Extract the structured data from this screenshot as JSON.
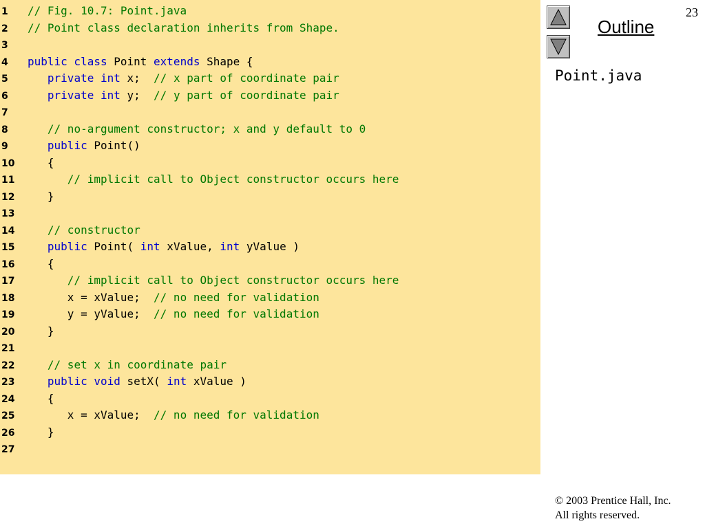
{
  "slide": {
    "number": "23",
    "outline_label": "Outline",
    "file_label": "Point.java",
    "copyright_line1": "© 2003 Prentice Hall, Inc.",
    "copyright_line2": "All rights reserved.",
    "icons": {
      "up": "triangle-up-icon",
      "down": "triangle-down-icon"
    },
    "colors": {
      "panel": "#fde59c",
      "keyword": "#0000cc",
      "comment": "#007700",
      "text": "#000000"
    }
  },
  "code": {
    "lines": [
      {
        "n": "1",
        "tokens": [
          {
            "t": "// Fig. 10.7: Point.java",
            "k": "com"
          }
        ]
      },
      {
        "n": "2",
        "tokens": [
          {
            "t": "// Point class declaration inherits from Shape.",
            "k": "com"
          }
        ]
      },
      {
        "n": "3",
        "tokens": []
      },
      {
        "n": "4",
        "tokens": [
          {
            "t": "public class",
            "k": "kw"
          },
          {
            "t": " Point ",
            "k": "plain"
          },
          {
            "t": "extends",
            "k": "kw"
          },
          {
            "t": " Shape {",
            "k": "plain"
          }
        ]
      },
      {
        "n": "5",
        "tokens": [
          {
            "t": "   ",
            "k": "plain"
          },
          {
            "t": "private int",
            "k": "kw"
          },
          {
            "t": " x;  ",
            "k": "plain"
          },
          {
            "t": "// x part of coordinate pair",
            "k": "com"
          }
        ]
      },
      {
        "n": "6",
        "tokens": [
          {
            "t": "   ",
            "k": "plain"
          },
          {
            "t": "private int",
            "k": "kw"
          },
          {
            "t": " y;  ",
            "k": "plain"
          },
          {
            "t": "// y part of coordinate pair",
            "k": "com"
          }
        ]
      },
      {
        "n": "7",
        "tokens": []
      },
      {
        "n": "8",
        "tokens": [
          {
            "t": "   ",
            "k": "plain"
          },
          {
            "t": "// no-argument constructor; x and y default to 0",
            "k": "com"
          }
        ]
      },
      {
        "n": "9",
        "tokens": [
          {
            "t": "   ",
            "k": "plain"
          },
          {
            "t": "public",
            "k": "kw"
          },
          {
            "t": " Point()",
            "k": "plain"
          }
        ]
      },
      {
        "n": "10",
        "tokens": [
          {
            "t": "   {",
            "k": "plain"
          }
        ]
      },
      {
        "n": "11",
        "tokens": [
          {
            "t": "      ",
            "k": "plain"
          },
          {
            "t": "// implicit call to Object constructor occurs here",
            "k": "com"
          }
        ]
      },
      {
        "n": "12",
        "tokens": [
          {
            "t": "   }",
            "k": "plain"
          }
        ]
      },
      {
        "n": "13",
        "tokens": []
      },
      {
        "n": "14",
        "tokens": [
          {
            "t": "   ",
            "k": "plain"
          },
          {
            "t": "// constructor",
            "k": "com"
          }
        ]
      },
      {
        "n": "15",
        "tokens": [
          {
            "t": "   ",
            "k": "plain"
          },
          {
            "t": "public",
            "k": "kw"
          },
          {
            "t": " Point( ",
            "k": "plain"
          },
          {
            "t": "int",
            "k": "kw"
          },
          {
            "t": " xValue, ",
            "k": "plain"
          },
          {
            "t": "int",
            "k": "kw"
          },
          {
            "t": " yValue )",
            "k": "plain"
          }
        ]
      },
      {
        "n": "16",
        "tokens": [
          {
            "t": "   {",
            "k": "plain"
          }
        ]
      },
      {
        "n": "17",
        "tokens": [
          {
            "t": "      ",
            "k": "plain"
          },
          {
            "t": "// implicit call to Object constructor occurs here",
            "k": "com"
          }
        ]
      },
      {
        "n": "18",
        "tokens": [
          {
            "t": "      x = xValue;  ",
            "k": "plain"
          },
          {
            "t": "// no need for validation",
            "k": "com"
          }
        ]
      },
      {
        "n": "19",
        "tokens": [
          {
            "t": "      y = yValue;  ",
            "k": "plain"
          },
          {
            "t": "// no need for validation",
            "k": "com"
          }
        ]
      },
      {
        "n": "20",
        "tokens": [
          {
            "t": "   }",
            "k": "plain"
          }
        ]
      },
      {
        "n": "21",
        "tokens": []
      },
      {
        "n": "22",
        "tokens": [
          {
            "t": "   ",
            "k": "plain"
          },
          {
            "t": "// set x in coordinate pair",
            "k": "com"
          }
        ]
      },
      {
        "n": "23",
        "tokens": [
          {
            "t": "   ",
            "k": "plain"
          },
          {
            "t": "public void",
            "k": "kw"
          },
          {
            "t": " setX( ",
            "k": "plain"
          },
          {
            "t": "int",
            "k": "kw"
          },
          {
            "t": " xValue )",
            "k": "plain"
          }
        ]
      },
      {
        "n": "24",
        "tokens": [
          {
            "t": "   {",
            "k": "plain"
          }
        ]
      },
      {
        "n": "25",
        "tokens": [
          {
            "t": "      x = xValue;  ",
            "k": "plain"
          },
          {
            "t": "// no need for validation",
            "k": "com"
          }
        ]
      },
      {
        "n": "26",
        "tokens": [
          {
            "t": "   }",
            "k": "plain"
          }
        ]
      },
      {
        "n": "27",
        "tokens": []
      }
    ]
  }
}
